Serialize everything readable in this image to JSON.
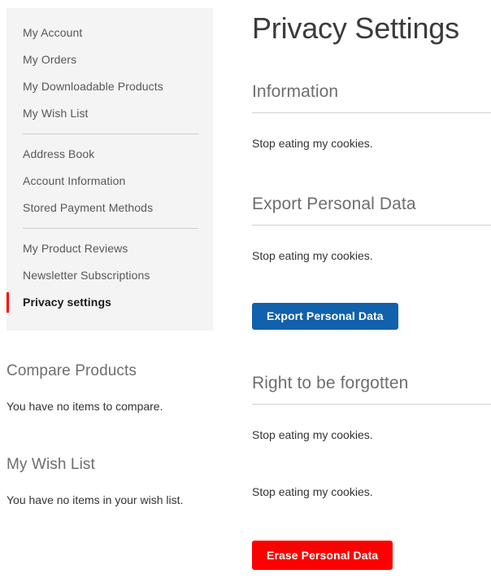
{
  "sidebar": {
    "nav": [
      {
        "label": "My Account",
        "current": false,
        "divider_after": false
      },
      {
        "label": "My Orders",
        "current": false,
        "divider_after": false
      },
      {
        "label": "My Downloadable Products",
        "current": false,
        "divider_after": false
      },
      {
        "label": "My Wish List",
        "current": false,
        "divider_after": true
      },
      {
        "label": "Address Book",
        "current": false,
        "divider_after": false
      },
      {
        "label": "Account Information",
        "current": false,
        "divider_after": false
      },
      {
        "label": "Stored Payment Methods",
        "current": false,
        "divider_after": true
      },
      {
        "label": "My Product Reviews",
        "current": false,
        "divider_after": false
      },
      {
        "label": "Newsletter Subscriptions",
        "current": false,
        "divider_after": false
      },
      {
        "label": "Privacy settings",
        "current": true,
        "divider_after": false
      }
    ],
    "compare": {
      "title": "Compare Products",
      "empty_text": "You have no items to compare."
    },
    "wishlist": {
      "title": "My Wish List",
      "empty_text": "You have no items in your wish list."
    }
  },
  "main": {
    "page_title": "Privacy Settings",
    "information": {
      "title": "Information",
      "text": "Stop eating my cookies."
    },
    "export": {
      "title": "Export Personal Data",
      "text": "Stop eating my cookies.",
      "button_label": "Export Personal Data"
    },
    "forgotten": {
      "title": "Right to be forgotten",
      "text_1": "Stop eating my cookies.",
      "text_2": "Stop eating my cookies.",
      "button_label": "Erase Personal Data"
    }
  },
  "colors": {
    "accent_red": "#ff0000",
    "primary_blue": "#1161ac",
    "sidebar_bg": "#f4f4f4",
    "text_default": "#333333",
    "text_muted": "#6e6e6e"
  }
}
